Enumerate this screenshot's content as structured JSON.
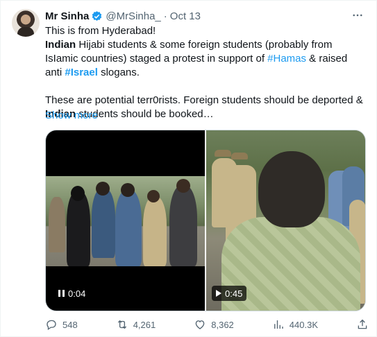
{
  "tweet": {
    "author_name": "Mr Sinha",
    "handle": "@MrSinha_",
    "separator": "·",
    "date": "Oct 13",
    "more_icon": "more-horizontal-icon",
    "text": {
      "line1": "This is from Hyderabad!",
      "p1_bold1": "Indian",
      "p1_a": " Hijabi students & some foreign students (probably from IsIamic countries) staged a protest in support of ",
      "p1_tag1": "#Hamas",
      "p1_b": " & raised anti ",
      "p1_tag2": "#Israel",
      "p1_c": " slogans.",
      "p2_a": "These are potential terr0rists. Foreign students should be deported & ",
      "p2_bold": "Indian",
      "p2_b": " students should be booked…"
    },
    "show_more": "Show more",
    "media": {
      "video1_duration": "0:04",
      "video2_duration": "0:45"
    },
    "actions": {
      "replies": "548",
      "reposts": "4,261",
      "likes": "8,362",
      "views": "440.3K"
    },
    "colors": {
      "accent": "#1d9bf0",
      "secondary_text": "#536471",
      "primary_text": "#0f1419"
    }
  }
}
